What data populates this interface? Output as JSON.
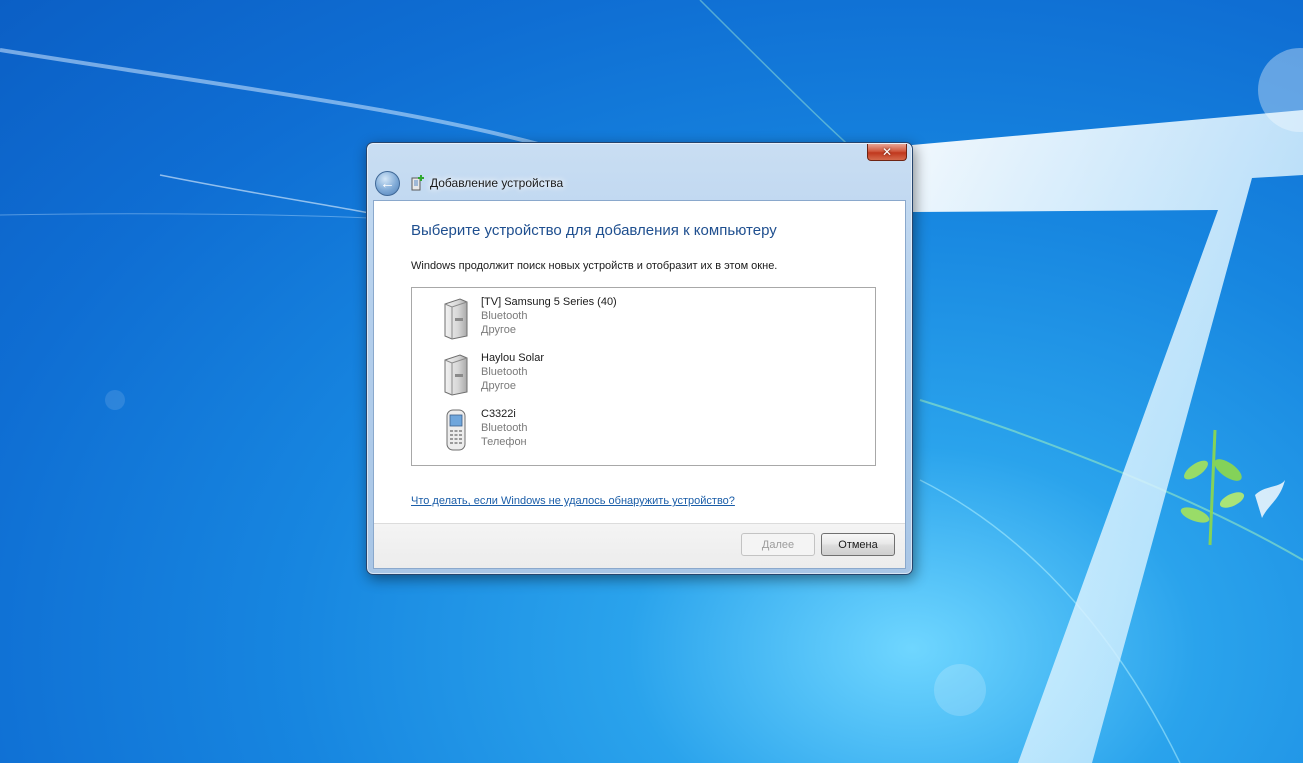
{
  "dialog": {
    "title": "Добавление устройства",
    "heading": "Выберите устройство для добавления к компьютеру",
    "info": "Windows продолжит поиск новых устройств и отобразит их в этом окне.",
    "devices": [
      {
        "name": "[TV] Samsung 5 Series (40)",
        "connection": "Bluetooth",
        "category": "Другое",
        "icon": "generic-device-icon"
      },
      {
        "name": "Haylou Solar",
        "connection": "Bluetooth",
        "category": "Другое",
        "icon": "generic-device-icon"
      },
      {
        "name": "C3322i",
        "connection": "Bluetooth",
        "category": "Телефон",
        "icon": "mobile-phone-icon"
      }
    ],
    "help_link": "Что делать, если Windows не удалось обнаружить устройство?",
    "buttons": {
      "next": "Далее",
      "cancel": "Отмена"
    },
    "close_glyph": "✕",
    "back_glyph": "←"
  },
  "colors": {
    "heading": "#1f4f8f",
    "link": "#1a5da8",
    "secondary_text": "#7a7a7a",
    "desktop_blue": "#1786e0"
  }
}
